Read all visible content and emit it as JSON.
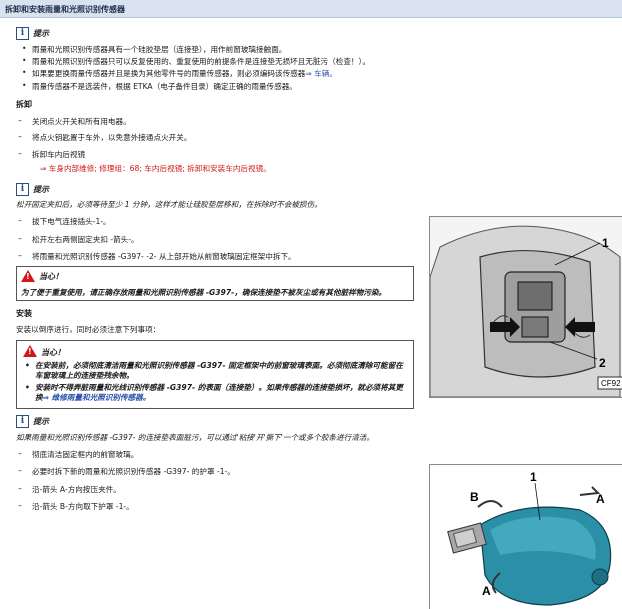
{
  "title": "拆卸和安装雨量和光照识别传感器",
  "hint1": {
    "label": "提示",
    "items": [
      "雨量和光照识别传感器具有一个硅胶垫层（连接垫），用作前窗玻璃接触面。",
      "雨量和光照识别传感器只可以反复使用的、重复使用的前提条件是连接垫无损坏且无脏污（检查！）。",
      "如果要更换雨量传感器并且是换为其他零件号的雨量传感器，则必须编码该传感器",
      "雨量传感器不是选装件，根据 ETKA（电子备件目录）确定正确的雨量传感器。"
    ],
    "link_text": "⇒ 车辆。"
  },
  "remove_heading": "拆卸",
  "steps1": [
    "关闭点火开关和所有用电器。",
    "将点火钥匙置于车外，以免意外接通点火开关。",
    "拆卸车内后视镜"
  ],
  "ref1": "⇒ 车身内部维修; 修理组：68; 车内后视镜; 拆卸和安装车内后视镜。",
  "hint2": {
    "label": "提示",
    "text": "松开固定夹扣后，必须等待至少 1 分钟，这样才能让硅胶垫层移和，在拆除时不会被损伤。"
  },
  "steps2": [
    "拔下电气连接插头-1-。",
    "松开左右两侧固定夹扣 -箭头-。",
    "将雨量和光照识别传感器 -G397- -2- 从上部开始从前窗玻璃固定框架中拆下。"
  ],
  "caution1": {
    "label": "当心！",
    "text": "为了便于重复使用，请正确存放雨量和光照识别传感器 -G397-，确保连接垫不被灰尘或有其他脏样物污染。"
  },
  "install_heading": "安装",
  "install_text": "安装以倒序进行，同时必须注意下列事项：",
  "caution2": {
    "label": "当心！",
    "items": [
      "在安装前，必须彻底清洁雨量和光照识别传感器 -G397- 固定框架中的前窗玻璃表面。必须彻底清除可能留在车窗玻璃上的连接垫残余物。",
      "安装时不得弄脏雨量和光线识别传感器 -G397- 的表面（连接垫）。如果传感器的连接垫损坏，就必须将其更换"
    ],
    "link_text": "⇒ 维修雨量和光照识别传感器。"
  },
  "hint3": {
    "label": "提示",
    "text": "如果雨量和光照识别传感器 -G397- 的连接垫表面脏污，可以通过'粘接'开'撕下'一个或多个胶条进行清洁。"
  },
  "steps3": [
    "彻底清洁固定框内的前窗玻璃。",
    "必要时拆下新的雨量和光照识别传感器 -G397- 的护罩 -1-。",
    "沿-箭头 A-方向按压夹件。",
    "沿-箭头 B-方向取下护罩 -1-。"
  ],
  "fig1": {
    "callout_1": "1",
    "callout_2": "2",
    "code": "CF92"
  },
  "fig2": {
    "callout_1": "1",
    "callout_a1": "A",
    "callout_a2": "A",
    "callout_b": "B"
  }
}
